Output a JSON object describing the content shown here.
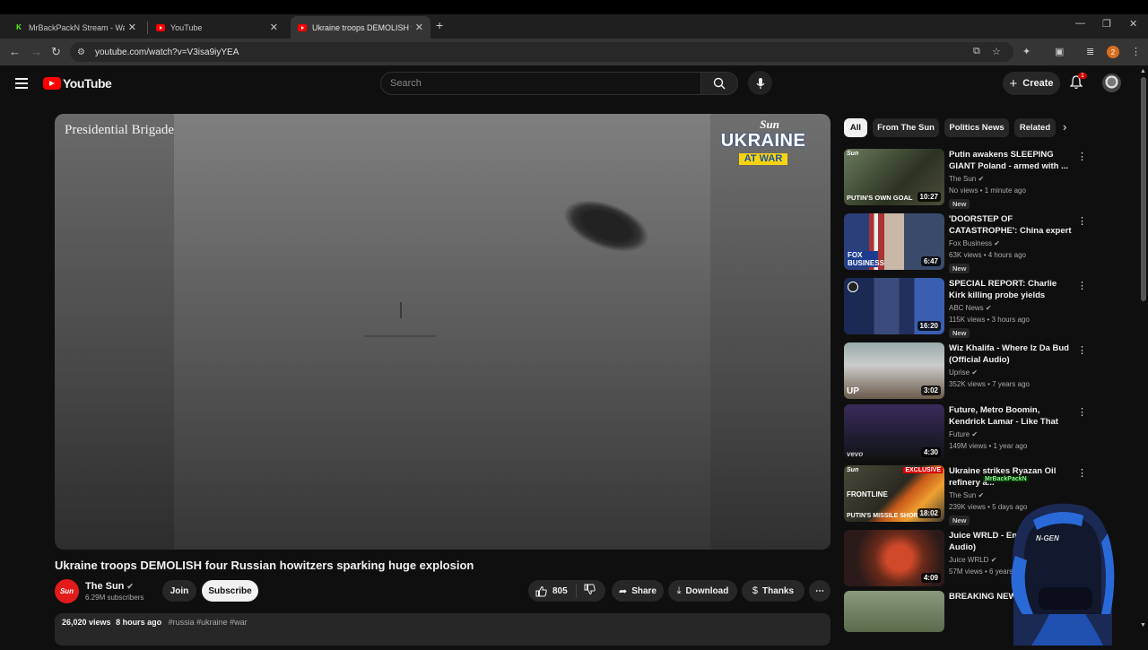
{
  "browser": {
    "tabs": [
      {
        "title": "MrBackPackN Stream - Watch Liv"
      },
      {
        "title": "YouTube"
      },
      {
        "title": "Ukraine troops DEMOLISH four"
      }
    ],
    "url": "youtube.com/watch?v=V3isa9iyYEA",
    "profile_initial": "2"
  },
  "header": {
    "logo": "YouTube",
    "search_placeholder": "Search",
    "create_label": "Create",
    "notification_count": "1"
  },
  "player": {
    "overlay_text": "Presidential Brigade",
    "brand_sun": "Sun",
    "brand_ukraine": "UKRAINE",
    "brand_at_war": "AT WAR"
  },
  "video": {
    "title": "Ukraine troops DEMOLISH four Russian howitzers sparking huge explosion",
    "channel": "The Sun",
    "channel_avatar_text": "Sun",
    "subscribers": "6.29M subscribers",
    "join_label": "Join",
    "subscribe_label": "Subscribe",
    "likes": "805",
    "share_label": "Share",
    "download_label": "Download",
    "thanks_label": "Thanks",
    "views": "26,020 views",
    "age": "8 hours ago",
    "tags": "#russia #ukraine #war"
  },
  "chips": [
    "All",
    "From The Sun",
    "Politics News",
    "Related"
  ],
  "recommendations": [
    {
      "title": "Putin awakens SLEEPING GIANT Poland - armed with ...",
      "channel": "The Sun",
      "views": "No views",
      "age": "1 minute ago",
      "duration": "10:27",
      "badge": "New",
      "thumb_caption": "PUTIN'S OWN GOAL"
    },
    {
      "title": "'DOORSTEP OF CATASTROPHE': China expert issues warning o...",
      "channel": "Fox Business",
      "views": "63K views",
      "age": "4 hours ago",
      "duration": "6:47",
      "badge": "New",
      "thumb_caption": "FOX BUSINESS"
    },
    {
      "title": "SPECIAL REPORT: Charlie Kirk killing probe yields recovery of...",
      "channel": "ABC News",
      "views": "115K views",
      "age": "3 hours ago",
      "duration": "16:20",
      "badge": "New",
      "thumb_caption": ""
    },
    {
      "title": "Wiz Khalifa - Where Iz Da Bud (Official Audio)",
      "channel": "Uprise",
      "views": "352K views",
      "age": "7 years ago",
      "duration": "3:02",
      "badge": "",
      "thumb_caption": "UP"
    },
    {
      "title": "Future, Metro Boomin, Kendrick Lamar - Like That (Official ...",
      "channel": "Future",
      "views": "149M views",
      "age": "1 year ago",
      "duration": "4:30",
      "badge": "",
      "thumb_caption": "vevo"
    },
    {
      "title": "Ukraine strikes Ryazan Oil refinery a...",
      "channel": "The Sun",
      "views": "239K views",
      "age": "5 days ago",
      "duration": "18:02",
      "badge": "New",
      "thumb_caption": "PUTIN'S MISSILE SHORTAGE",
      "thumb_tag": "EXCLUSIVE",
      "thumb_label": "FRONTLINE"
    },
    {
      "title": "Juice WRLD - Empty (Official Audio)",
      "channel": "Juice WRLD",
      "views": "57M views",
      "age": "6 years ago",
      "duration": "4:09",
      "badge": "",
      "thumb_caption": ""
    },
    {
      "title": "BREAKING NEWS",
      "channel": "",
      "views": "",
      "age": "",
      "duration": "",
      "badge": "",
      "thumb_caption": ""
    }
  ],
  "stream_overlay": {
    "label": "MrBackPackN",
    "chair_text": "N-GEN"
  }
}
